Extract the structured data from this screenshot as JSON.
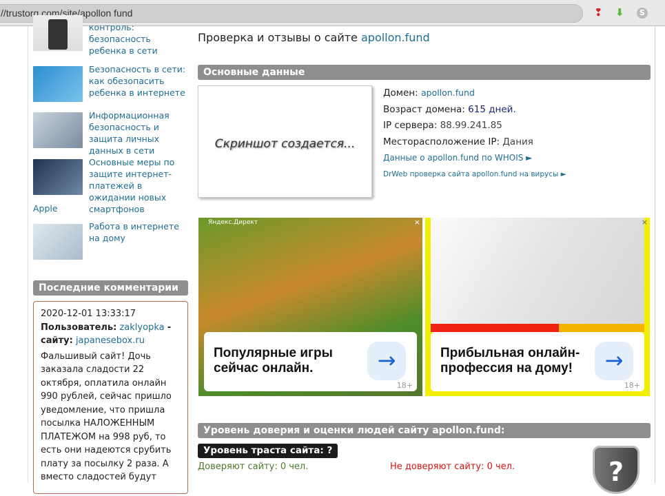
{
  "browser": {
    "url": "//trustorg com/site/apollon fund",
    "icons": [
      "pin-icon",
      "download-icon",
      "s-extension-icon"
    ]
  },
  "sidebar": {
    "articles": [
      {
        "title": "контроль: безопасность ребенка в сети"
      },
      {
        "title": "Безопасность в сети: как обезопасить ребенка в интернете"
      },
      {
        "title": "Информационная безопасность и защита личных данных в сети"
      },
      {
        "title": "Основные меры по защите интернет-платежей в ожидании новых смартфонов",
        "tail": "Apple"
      },
      {
        "title": "Работа в интернете на дому"
      }
    ],
    "comments_header": "Последние комментарии",
    "comment": {
      "date": "2020-12-01 13:33:17",
      "user_label": "Пользователь:",
      "user": "zaklyopka",
      "sep": "-",
      "site_label": "сайту:",
      "site": "japanesebox.ru",
      "text": "Фальшивый сайт! Дочь заказала сладости 22 октября, оплатила онлайн 990 рублей, сейчас пришло уведомление, что пришла посылка НАЛОЖЕННЫМ ПЛАТЕЖОМ на 998 руб, то есть они надеются срубить плату за посылку 2 раза. А вместо сладостей будут"
    }
  },
  "main": {
    "title_prefix": "Проверка и отзывы о сайте",
    "title_domain": "apollon.fund",
    "basic_header": "Основные данные",
    "screenshot_placeholder": "Скриншот создается...",
    "domain_label": "Домен:",
    "domain": "apollon.fund",
    "age_label": "Возраст домена:",
    "age": "615 дней.",
    "ip_label": "IP сервера:",
    "ip": "88.99.241.85",
    "loc_label": "Месторасположение IP:",
    "loc": "Дания",
    "whois_link": "Данные о apollon.fund по WHOIS ►",
    "drweb_link": "DrWeb проверка сайта apollon.fund на вирусы ►",
    "ads": [
      {
        "label": "Яндекс.Директ",
        "text": "Популярные игры сейчас онлайн.",
        "age": "18+",
        "close": "×",
        "arrow": "→"
      },
      {
        "text": "Прибыльная онлайн-профессия на дому!",
        "age": "18+",
        "close": "×",
        "arrow": "→"
      }
    ],
    "trust_header": "Уровень доверия и оценки людей сайту apollon.fund:",
    "trust_level": "Уровень траста сайта: ?",
    "trust_yes": "Доверяют сайту: 0 чел.",
    "trust_no": "Не доверяют сайту: 0 чел.",
    "shield_glyph": "?"
  }
}
